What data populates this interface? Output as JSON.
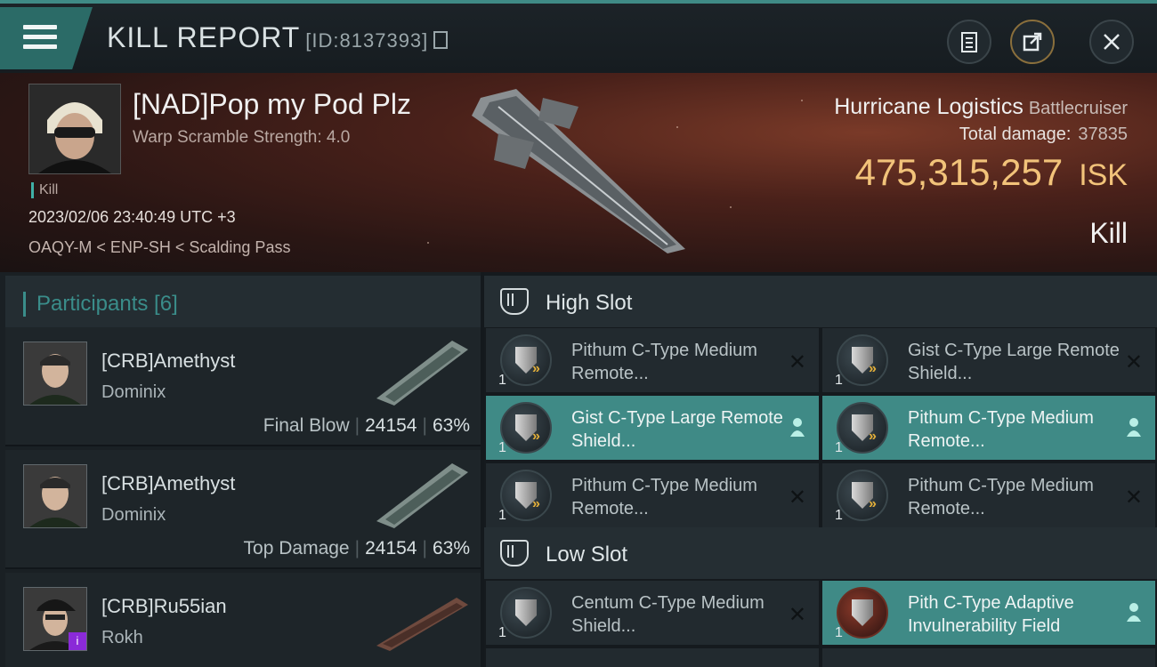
{
  "header": {
    "title": "KILL REPORT",
    "report_id": "[ID:8137393]"
  },
  "victim": {
    "name": "[NAD]Pop my Pod Plz",
    "scramble": "Warp Scramble Strength: 4.0",
    "tag": "Kill",
    "time": "2023/02/06 23:40:49 UTC +3",
    "location": "OAQY-M < ENP-SH < Scalding Pass",
    "ship_name": "Hurricane Logistics",
    "ship_class": "Battlecruiser",
    "damage_label": "Total damage:",
    "damage_value": "37835",
    "isk_value": "475,315,257",
    "isk_unit": "ISK",
    "result": "Kill"
  },
  "participants": {
    "label": "Participants [6]",
    "items": [
      {
        "name": "[CRB]Amethyst",
        "ship": "Dominix",
        "role": "Final Blow",
        "damage": "24154",
        "percent": "63%"
      },
      {
        "name": "[CRB]Amethyst",
        "ship": "Dominix",
        "role": "Top Damage",
        "damage": "24154",
        "percent": "63%"
      },
      {
        "name": "[CRB]Ru55ian",
        "ship": "Rokh",
        "badge": "i"
      }
    ]
  },
  "slots": {
    "high": {
      "label": "High Slot",
      "modules": [
        {
          "name": "Pithum C-Type Medium Remote...",
          "qty": "1",
          "status": "x"
        },
        {
          "name": "Gist C-Type Large Remote Shield...",
          "qty": "1",
          "status": "x"
        },
        {
          "name": "Gist C-Type Large Remote Shield...",
          "qty": "1",
          "status": "dropped"
        },
        {
          "name": "Pithum C-Type Medium Remote...",
          "qty": "1",
          "status": "dropped"
        },
        {
          "name": "Pithum C-Type Medium Remote...",
          "qty": "1",
          "status": "x"
        },
        {
          "name": "Pithum C-Type Medium Remote...",
          "qty": "1",
          "status": "x"
        }
      ]
    },
    "low": {
      "label": "Low Slot",
      "modules": [
        {
          "name": "Centum C-Type Medium Shield...",
          "qty": "1",
          "status": "x"
        },
        {
          "name": "Pith C-Type Adaptive Invulnerability Field",
          "qty": "1",
          "status": "dropped"
        }
      ]
    }
  },
  "colors": {
    "accent": "#3f8a86",
    "isk": "#f2c37a",
    "banner": "#4a211a"
  },
  "icons": {
    "menu": "hamburger-icon",
    "clipboard": "clipboard-icon",
    "share": "share-icon",
    "close": "close-icon",
    "slot": "slot-bracket-icon",
    "destroyed": "x-icon",
    "dropped": "person-icon"
  }
}
